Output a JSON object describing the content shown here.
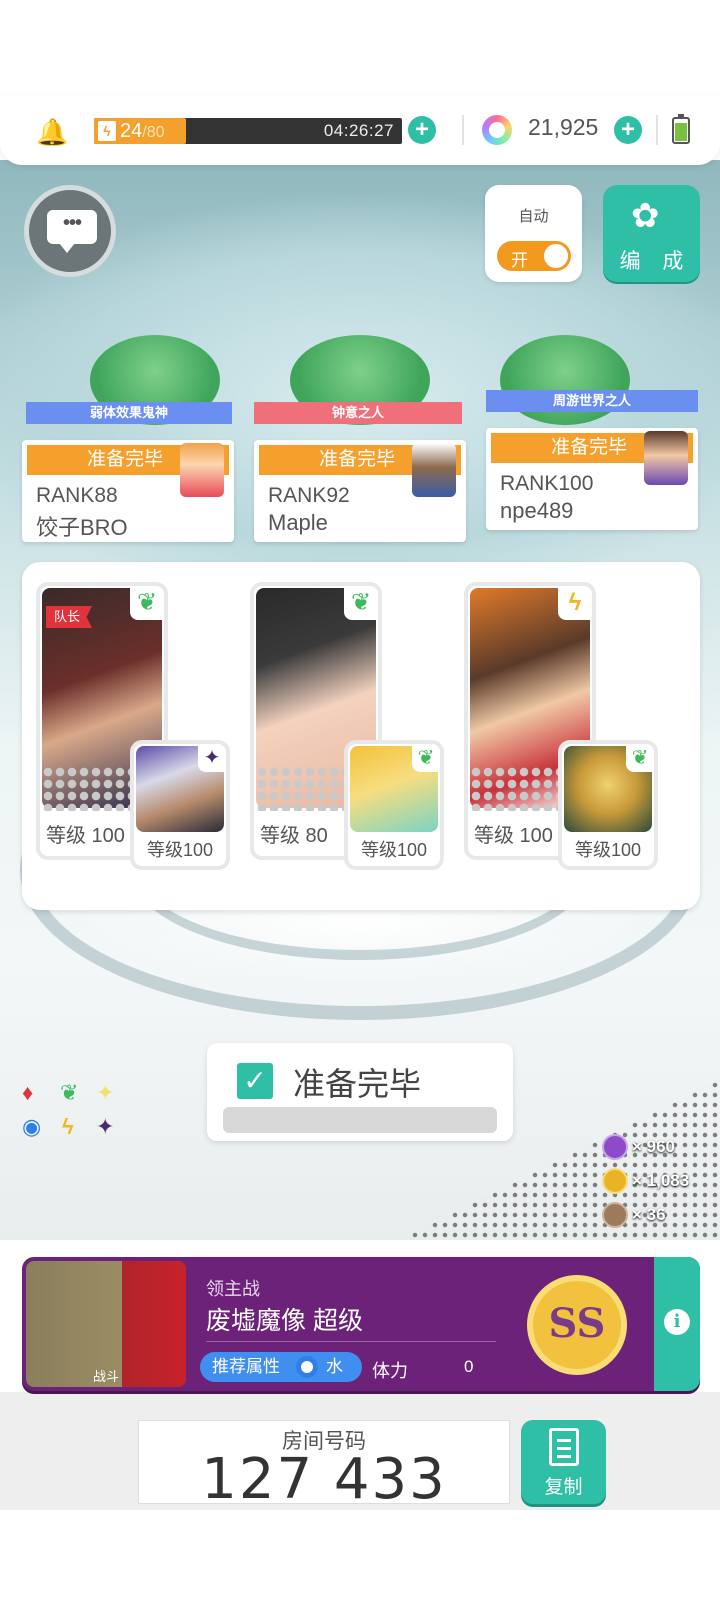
{
  "topbar": {
    "stamina_current": "24",
    "stamina_max": "/80",
    "stamina_fraction": 0.3,
    "timer": "04:26:27",
    "gems": "21,925"
  },
  "auto": {
    "label": "自动",
    "toggle": "开"
  },
  "formation_label": "编 成",
  "players": [
    {
      "title": "弱体效果鬼神",
      "status": "准备完毕",
      "rank": "RANK88",
      "name": "饺子BRO",
      "title_color": "#6b8ff0"
    },
    {
      "title": "钟意之人",
      "status": "准备完毕",
      "rank": "RANK92",
      "name": "Maple",
      "title_color": "#ef6f7a"
    },
    {
      "title": "周游世界之人",
      "status": "准备完毕",
      "rank": "RANK100",
      "name": "npe489",
      "title_color": "#6b8ff0"
    }
  ],
  "team": {
    "leader_label": "队长",
    "slots": [
      {
        "main_level": "等级 100",
        "sub_level": "等级100",
        "main_element": "leaf-icon",
        "sub_element": "dark-star-icon"
      },
      {
        "main_level": "等级 80",
        "sub_level": "等级100",
        "main_element": "leaf-icon",
        "sub_element": "leaf-icon"
      },
      {
        "main_level": "等级 100",
        "sub_level": "等级100",
        "main_element": "lightning-icon",
        "sub_element": "leaf-icon"
      }
    ]
  },
  "ready_button": {
    "label": "准备完毕"
  },
  "rewards": [
    {
      "icon": "purple-coin-icon",
      "amount": "× 960",
      "color": "#8e4bc9"
    },
    {
      "icon": "gold-coin-icon",
      "amount": "× 1,083",
      "color": "#e8b425"
    },
    {
      "icon": "bronze-coin-icon",
      "amount": "× 36",
      "color": "#9c7b5c"
    }
  ],
  "boss": {
    "type": "领主战",
    "name": "废墟魔像 超级",
    "fight_label": "战斗",
    "rec_label": "推荐属性",
    "rec_element": "水",
    "stamina_label": "体力",
    "stamina_cost": "0",
    "grade": "SS"
  },
  "room": {
    "label": "房间号码",
    "number": "127 433",
    "copy_label": "复制"
  },
  "colors": {
    "accent": "#2fbfa6",
    "orange": "#f5a02c",
    "boss_bg": "#6c2278"
  }
}
